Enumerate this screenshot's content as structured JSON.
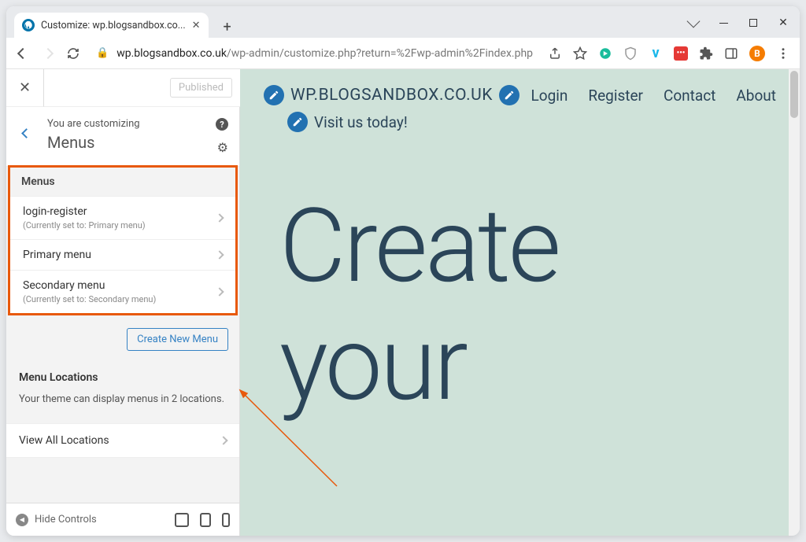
{
  "browser": {
    "tab_title": "Customize: wp.blogsandbox.co...",
    "url_prefix": "wp.blogsandbox.co.uk",
    "url_suffix": "/wp-admin/customize.php?return=%2Fwp-admin%2Findex.php",
    "profile_letter": "B"
  },
  "customizer": {
    "published_label": "Published",
    "customizing_label": "You are customizing",
    "panel_title": "Menus",
    "section_heading": "Menus",
    "menus": [
      {
        "name": "login-register",
        "meta": "(Currently set to: Primary menu)"
      },
      {
        "name": "Primary menu",
        "meta": ""
      },
      {
        "name": "Secondary menu",
        "meta": "(Currently set to: Secondary menu)"
      }
    ],
    "create_button": "Create New Menu",
    "locations_heading": "Menu Locations",
    "locations_desc": "Your theme can display menus in 2 locations.",
    "view_all_label": "View All Locations",
    "hide_controls": "Hide Controls"
  },
  "preview": {
    "site_title": "WP.BLOGSANDBOX.CO.UK",
    "tagline": "Visit us today!",
    "nav": [
      "Login",
      "Register",
      "Contact",
      "About"
    ],
    "hero_line1": "Create",
    "hero_line2": "your"
  }
}
